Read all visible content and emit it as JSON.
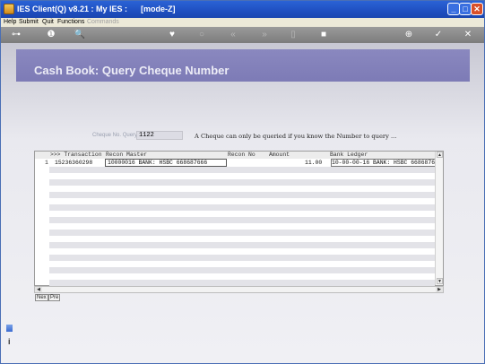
{
  "window": {
    "title": "IES Client(Q) v8.21 : My IES :      [mode-Z]",
    "minimize": "_",
    "maximize": "□",
    "close": "✕"
  },
  "menu": {
    "items": [
      "Help",
      "Submit",
      "Quit",
      "Functions"
    ],
    "disabled_item": "Commands"
  },
  "toolbar": {
    "icons": [
      "key-icon",
      "info-icon",
      "search-icon",
      "heart-icon",
      "refresh-icon",
      "rewind-icon",
      "fast-forward-icon",
      "page-icon",
      "stop-icon",
      "lock-icon",
      "check-icon",
      "close-icon"
    ],
    "glyphs": [
      "⊶",
      "❶",
      "🔍",
      "♥",
      "○",
      "«",
      "»",
      "▯",
      "■",
      "⊕",
      "✓",
      "✕"
    ]
  },
  "page": {
    "title": "Cash Book: Query Cheque Number"
  },
  "query": {
    "label": "Cheque No. Query",
    "value": "1122",
    "hint": "A Cheque can only be queried if you know the Number to query ..."
  },
  "grid": {
    "headers": [
      ">>> Transaction",
      "Recon Master",
      "Recon No",
      "Amount",
      "Bank Ledger"
    ],
    "rows": [
      {
        "num": "1",
        "transaction": "15236360298",
        "recon_master": "10000016 BANK: HSBC 668687666",
        "recon_no": "",
        "amount": "11.00",
        "bank_ledger": "10-00-00-16 BANK: HSBC 668687666"
      }
    ],
    "empty_row_count": 19
  },
  "nav": {
    "next": "Nex",
    "prev": "Pre"
  }
}
